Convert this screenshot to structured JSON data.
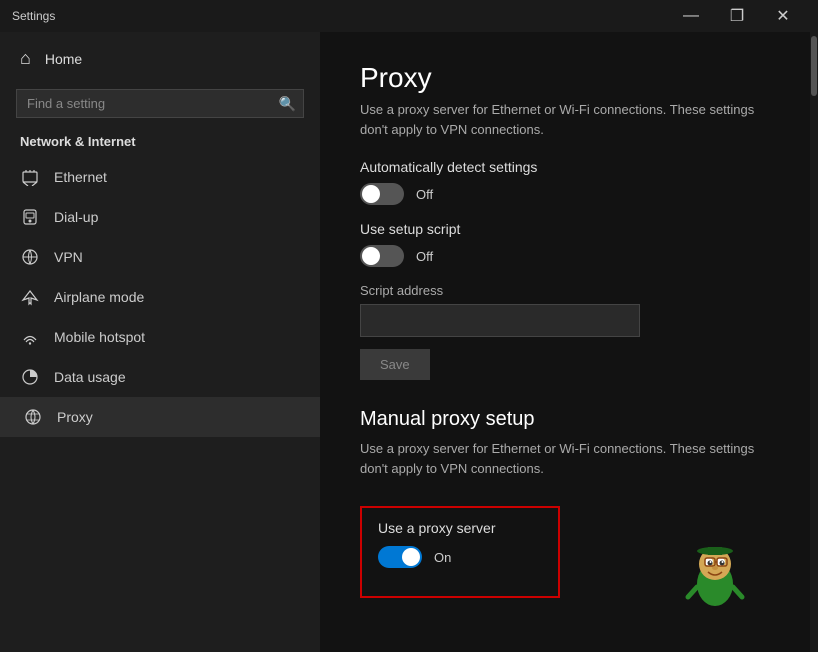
{
  "titlebar": {
    "title": "Settings",
    "minimize": "—",
    "restore": "❐",
    "close": "✕"
  },
  "sidebar": {
    "home_label": "Home",
    "search_placeholder": "Find a setting",
    "section_title": "Network & Internet",
    "nav_items": [
      {
        "id": "ethernet",
        "label": "Ethernet",
        "icon": "ethernet"
      },
      {
        "id": "dialup",
        "label": "Dial-up",
        "icon": "dialup"
      },
      {
        "id": "vpn",
        "label": "VPN",
        "icon": "vpn"
      },
      {
        "id": "airplane",
        "label": "Airplane mode",
        "icon": "airplane"
      },
      {
        "id": "hotspot",
        "label": "Mobile hotspot",
        "icon": "hotspot"
      },
      {
        "id": "datausage",
        "label": "Data usage",
        "icon": "data"
      },
      {
        "id": "proxy",
        "label": "Proxy",
        "icon": "proxy",
        "active": true
      }
    ]
  },
  "main": {
    "page_title": "Proxy",
    "auto_section": {
      "desc": "Use a proxy server for Ethernet or Wi-Fi connections. These settings don't apply to VPN connections.",
      "auto_detect_label": "Automatically detect settings",
      "auto_detect_value": "Off",
      "auto_detect_state": "off",
      "setup_script_label": "Use setup script",
      "setup_script_value": "Off",
      "setup_script_state": "off",
      "script_address_label": "Script address",
      "script_address_value": "",
      "save_label": "Save"
    },
    "manual_section": {
      "title": "Manual proxy setup",
      "desc": "Use a proxy server for Ethernet or Wi-Fi connections. These settings don't apply to VPN connections.",
      "use_proxy_label": "Use a proxy server",
      "use_proxy_value": "On",
      "use_proxy_state": "on"
    }
  },
  "icons": {
    "home": "⌂",
    "search": "🔍",
    "ethernet": "🖥",
    "dialup": "☎",
    "vpn": "🔗",
    "airplane": "✈",
    "hotspot": "📶",
    "data": "📊",
    "proxy": "🌐"
  }
}
